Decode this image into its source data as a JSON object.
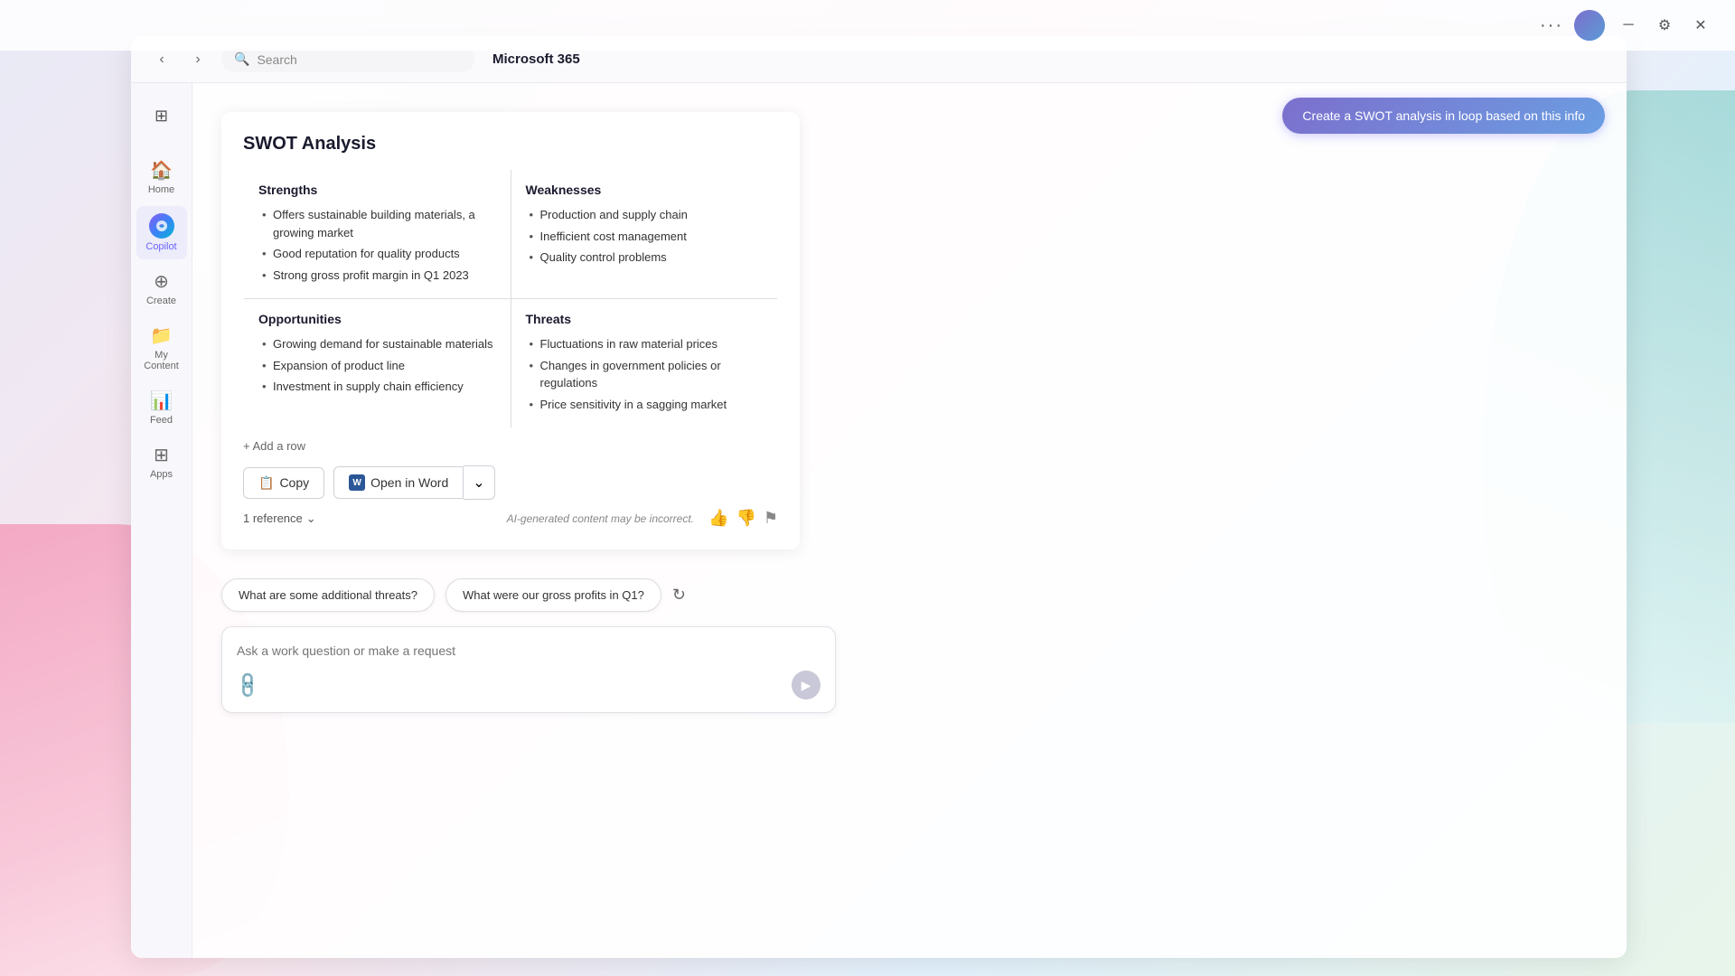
{
  "app": {
    "title": "Microsoft 365"
  },
  "topbar": {
    "dots": "···",
    "window_controls": [
      "minimize",
      "settings",
      "close"
    ]
  },
  "toolbar": {
    "search_placeholder": "Search"
  },
  "sidebar": {
    "grid_icon": "⊞",
    "items": [
      {
        "id": "home",
        "label": "Home",
        "icon": "🏠"
      },
      {
        "id": "copilot",
        "label": "Copilot",
        "icon": "copilot",
        "active": true
      },
      {
        "id": "create",
        "label": "Create",
        "icon": "➕"
      },
      {
        "id": "my-content",
        "label": "My Content",
        "icon": "📁"
      },
      {
        "id": "feed",
        "label": "Feed",
        "icon": "📊"
      },
      {
        "id": "apps",
        "label": "Apps",
        "icon": "⊞"
      }
    ]
  },
  "swot_button": {
    "label": "Create a SWOT analysis in loop based on this info"
  },
  "swot": {
    "title": "SWOT Analysis",
    "strengths": {
      "heading": "Strengths",
      "items": [
        "Offers sustainable building materials, a growing market",
        "Good reputation for quality products",
        "Strong gross profit margin in Q1 2023"
      ]
    },
    "weaknesses": {
      "heading": "Weaknesses",
      "items": [
        "Production and supply chain",
        "Inefficient cost management",
        "Quality control problems"
      ]
    },
    "opportunities": {
      "heading": "Opportunities",
      "items": [
        "Growing demand for sustainable materials",
        "Expansion of product line",
        "Investment in supply chain efficiency"
      ]
    },
    "threats": {
      "heading": "Threats",
      "items": [
        "Fluctuations in raw material prices",
        "Changes in government policies or regulations",
        "Price sensitivity in a sagging market"
      ]
    },
    "add_row": "+ Add a row"
  },
  "actions": {
    "copy": "Copy",
    "open_in_word": "Open in Word"
  },
  "feedback": {
    "reference_label": "1 reference",
    "ai_disclaimer": "AI-generated content may be incorrect."
  },
  "suggestions": {
    "chips": [
      "What are some additional threats?",
      "What were our gross profits in Q1?"
    ]
  },
  "input": {
    "placeholder": "Ask a work question or make a request"
  }
}
